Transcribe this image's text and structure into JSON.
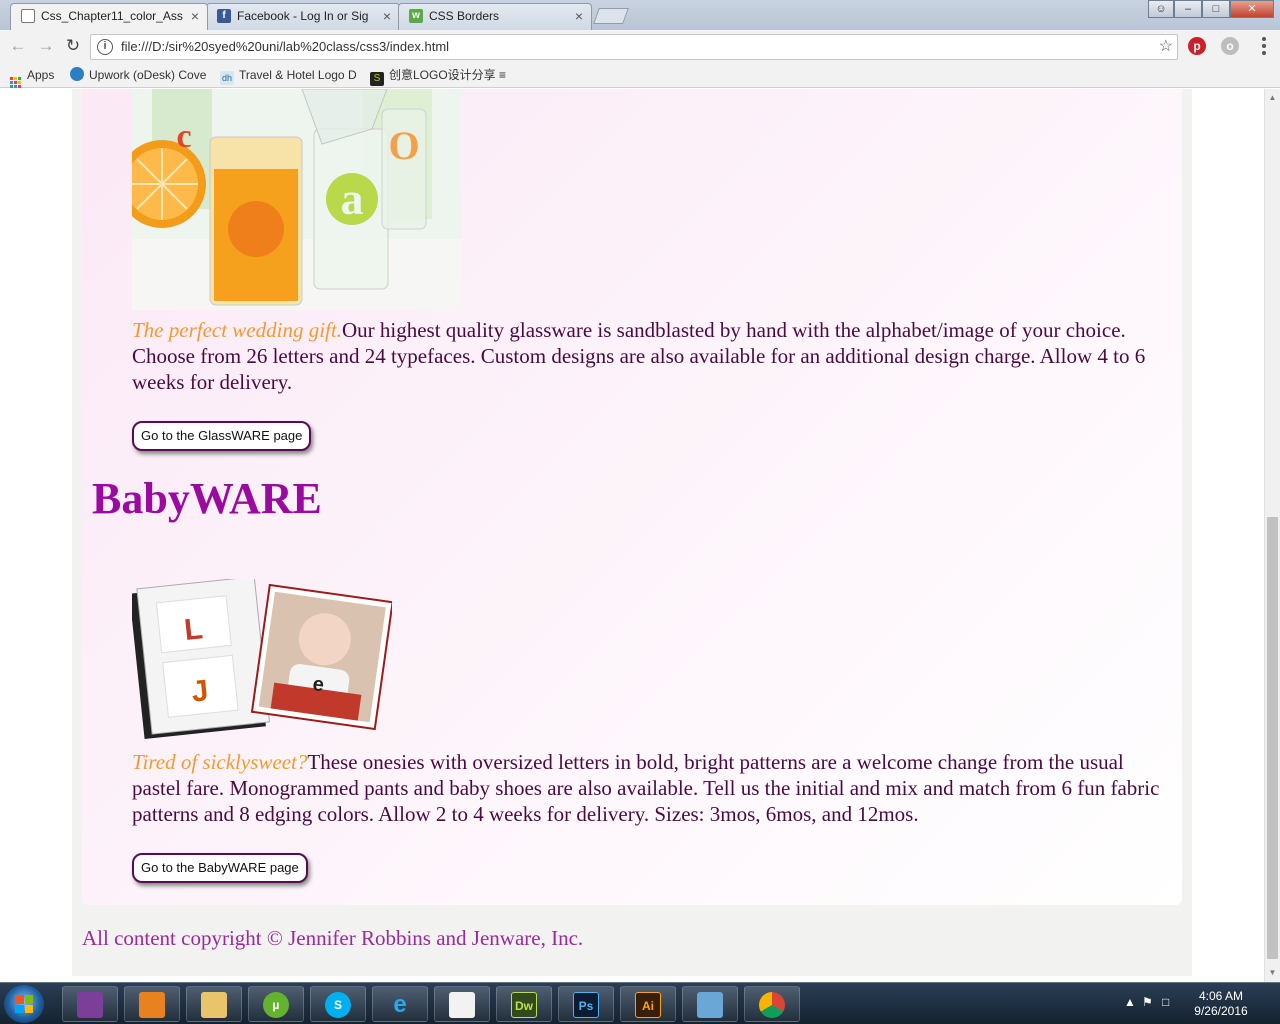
{
  "browser": {
    "tabs": [
      {
        "title": "Css_Chapter11_color_Ass",
        "active": true,
        "icon_name": "page-icon"
      },
      {
        "title": "Facebook - Log In or Sig",
        "active": false,
        "icon_name": "facebook-icon"
      },
      {
        "title": "CSS Borders",
        "active": false,
        "icon_name": "w3schools-icon"
      }
    ],
    "close_glyph": "×",
    "url": "file:///D:/sir%20syed%20uni/lab%20class/css3/index.html",
    "bookmarks": [
      {
        "label": "Apps"
      },
      {
        "label": "Upwork (oDesk) Cove"
      },
      {
        "label": "Travel & Hotel Logo D"
      },
      {
        "label": "创意LOGO设计分享 ≡"
      }
    ]
  },
  "page": {
    "glassware": {
      "lead": "The perfect wedding gift.",
      "text": "Our highest quality glassware is sandblasted by hand with the alphabet/image of your choice. Choose from 26 letters and 24 typefaces. Custom designs are also available for an additional design charge. Allow 4 to 6 weeks for delivery.",
      "button": "Go to the GlassWARE page"
    },
    "babyware": {
      "heading": "BabyWARE",
      "lead": "Tired of sicklysweet?",
      "text": "These onesies with oversized letters in bold, bright patterns are a welcome change from the usual pastel fare. Monogrammed pants and baby shoes are also available. Tell us the initial and mix and match from 6 fun fabric patterns and 8 edging colors. Allow 2 to 4 weeks for delivery. Sizes: 3mos, 6mos, and 12mos.",
      "button": "Go to the BabyWARE page",
      "photo_letters": [
        "L",
        "J",
        "e"
      ]
    },
    "footer": "All content copyright © Jennifer Robbins and Jenware, Inc."
  },
  "glass_letters": [
    "c",
    "a",
    "O"
  ],
  "taskbar": {
    "apps": [
      {
        "name": "winrar-icon",
        "label": ""
      },
      {
        "name": "media-player-icon",
        "label": ""
      },
      {
        "name": "file-explorer-icon",
        "label": ""
      },
      {
        "name": "utorrent-icon",
        "label": "µ"
      },
      {
        "name": "skype-icon",
        "label": "S"
      },
      {
        "name": "internet-explorer-icon",
        "label": "e"
      },
      {
        "name": "acrobat-icon",
        "label": ""
      },
      {
        "name": "dreamweaver-icon",
        "label": "Dw"
      },
      {
        "name": "photoshop-icon",
        "label": "Ps"
      },
      {
        "name": "illustrator-icon",
        "label": "Ai"
      },
      {
        "name": "photo-viewer-icon",
        "label": ""
      },
      {
        "name": "chrome-icon",
        "label": ""
      }
    ],
    "time": "4:06 AM",
    "date": "9/26/2016"
  },
  "colors": {
    "heading": "#9a0aa0",
    "lead_text": "#f29a30",
    "body_text": "#4a0a40",
    "footer_text": "#9a2a9a",
    "button_border": "#5a0a55"
  }
}
